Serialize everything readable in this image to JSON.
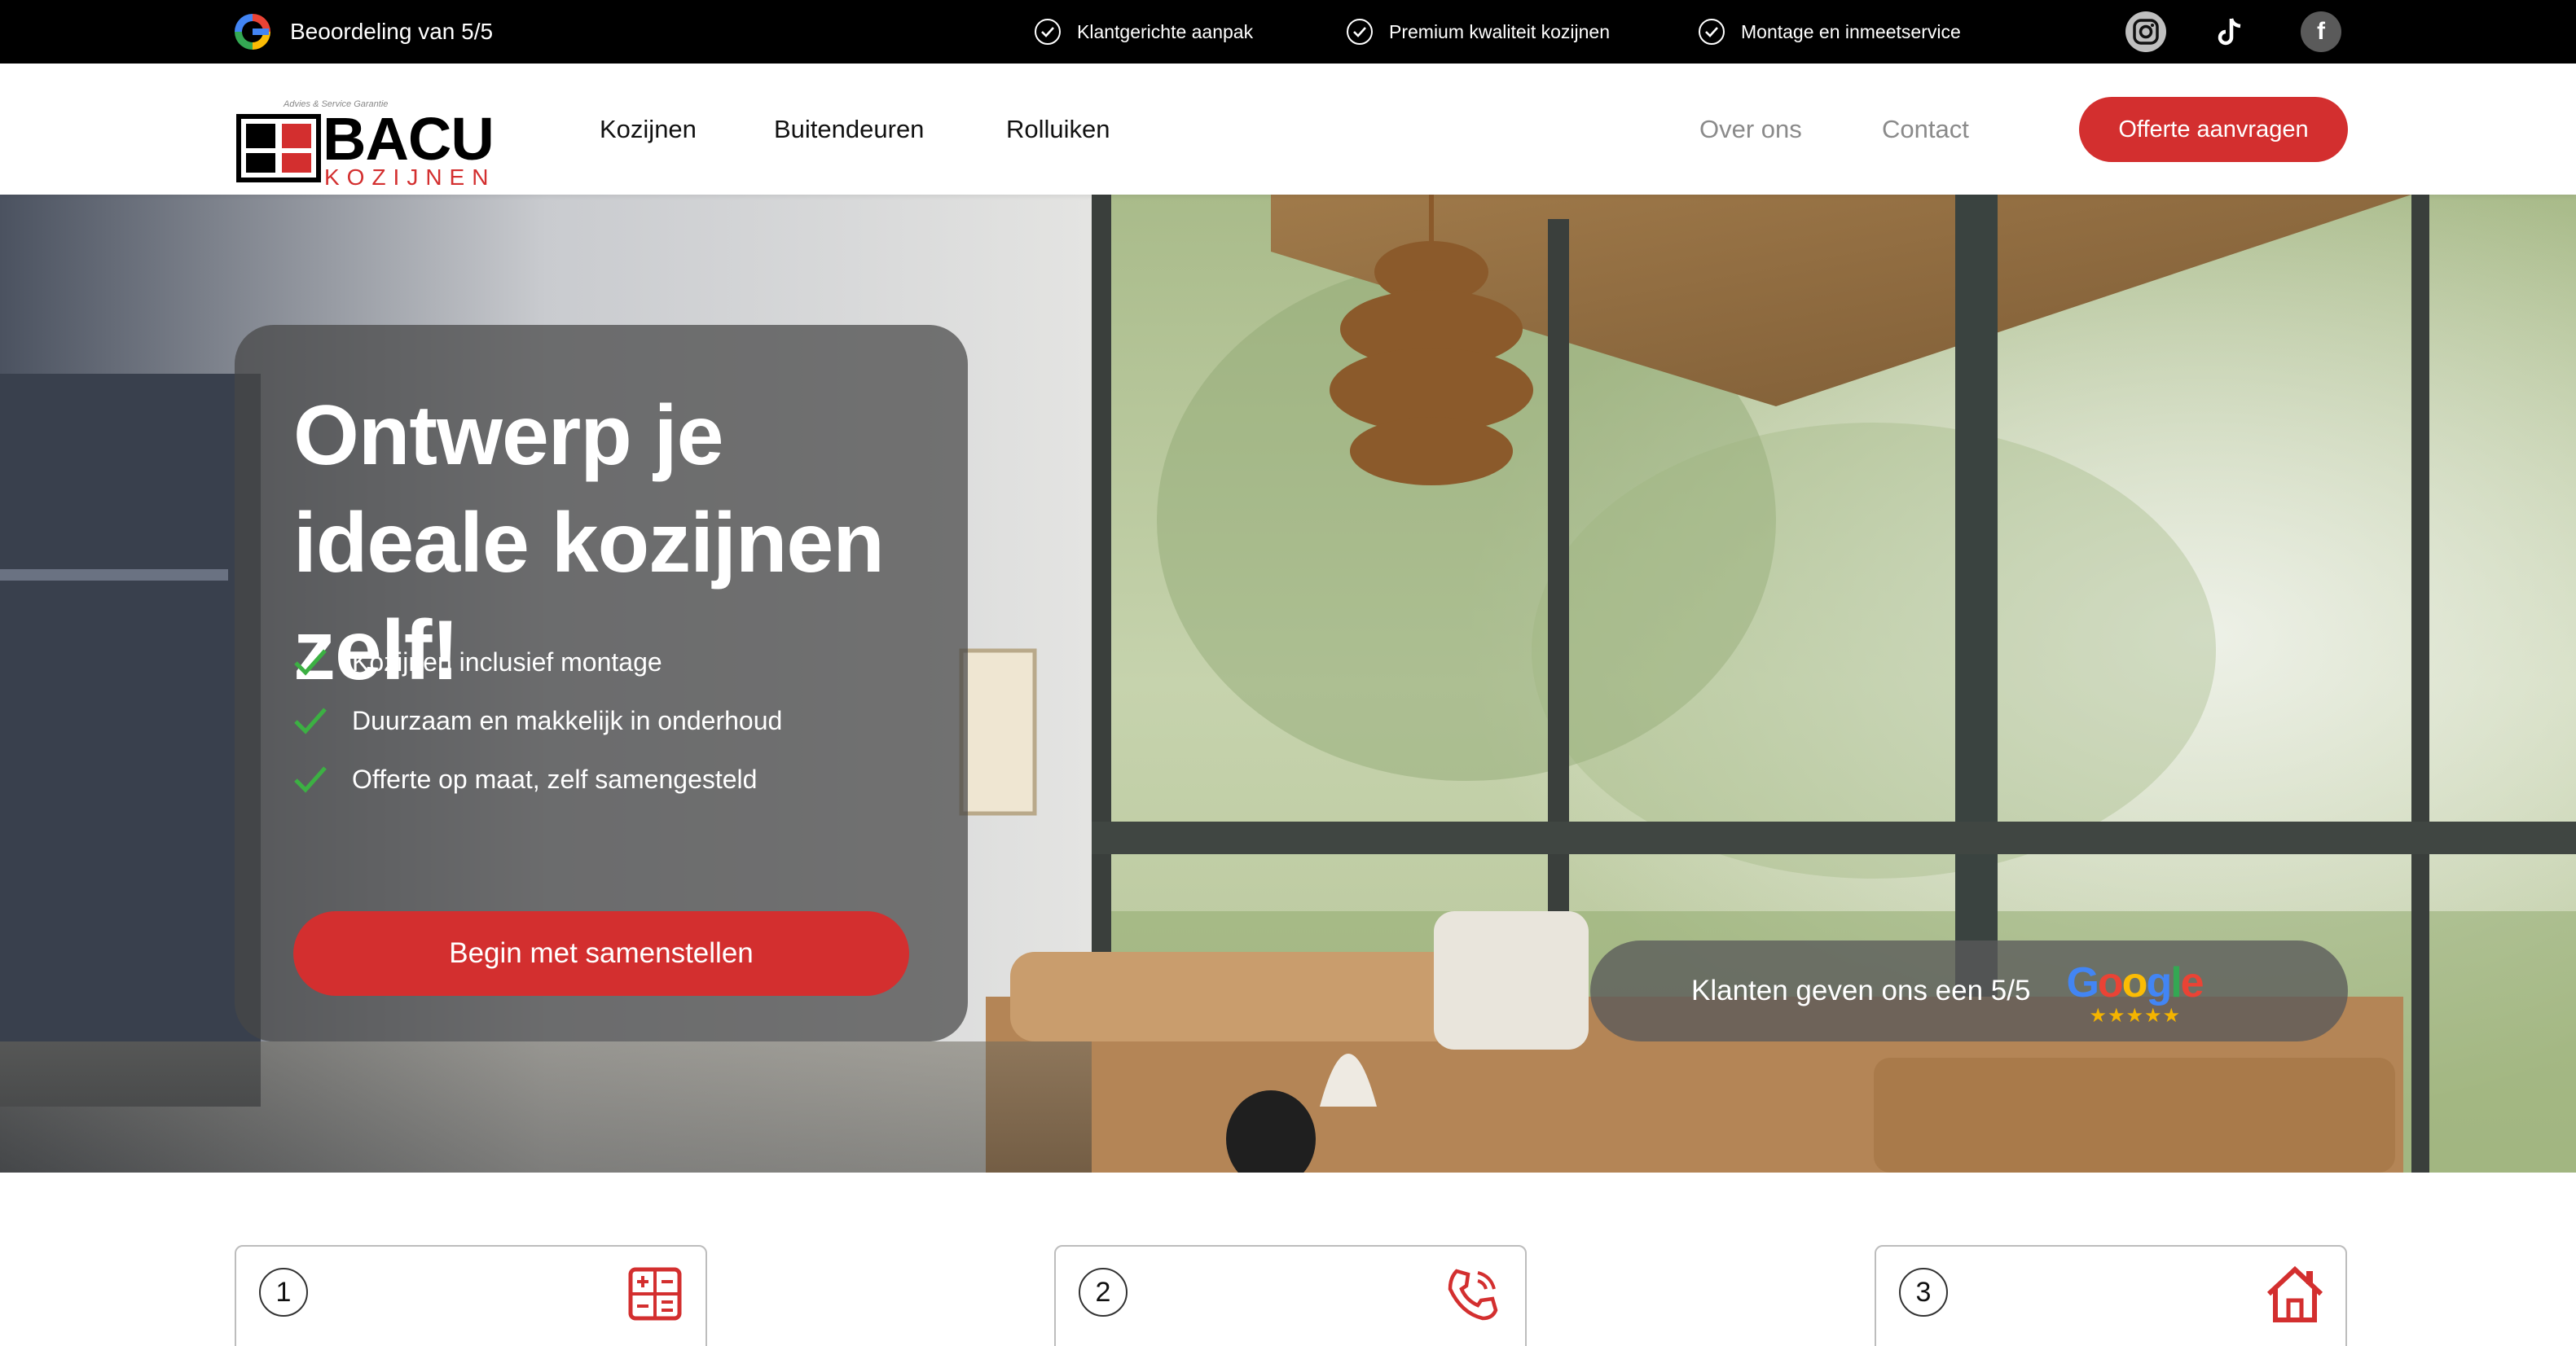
{
  "topbar": {
    "rating_text": "Beoordeling van 5/5",
    "usps": [
      "Klantgerichte aanpak",
      "Premium kwaliteit kozijnen",
      "Montage en inmeetservice"
    ],
    "socials": [
      "instagram-icon",
      "tiktok-icon",
      "facebook-icon"
    ]
  },
  "nav": {
    "logo_brand": "BACU",
    "logo_sub": "KOZIJNEN",
    "logo_tagline": "Advies & Service Garantie",
    "links_left": [
      "Kozijnen",
      "Buitendeuren",
      "Rolluiken"
    ],
    "links_right": [
      "Over ons",
      "Contact"
    ],
    "cta": "Offerte aanvragen"
  },
  "hero": {
    "title": "Ontwerp je ideale kozijnen zelf!",
    "bullets": [
      "Kozijnen inclusief montage",
      "Duurzaam en makkelijk in onderhoud",
      "Offerte op maat, zelf samengesteld"
    ],
    "button": "Begin met samenstellen",
    "review_text": "Klanten geven ons een 5/5",
    "google_word": "Google",
    "stars": "★★★★★"
  },
  "steps": [
    {
      "number": "1",
      "icon": "calculator-icon"
    },
    {
      "number": "2",
      "icon": "phone-call-icon"
    },
    {
      "number": "3",
      "icon": "house-icon"
    }
  ],
  "colors": {
    "accent": "#d32f2f",
    "topbar": "#000000",
    "check": "#3cb043"
  }
}
